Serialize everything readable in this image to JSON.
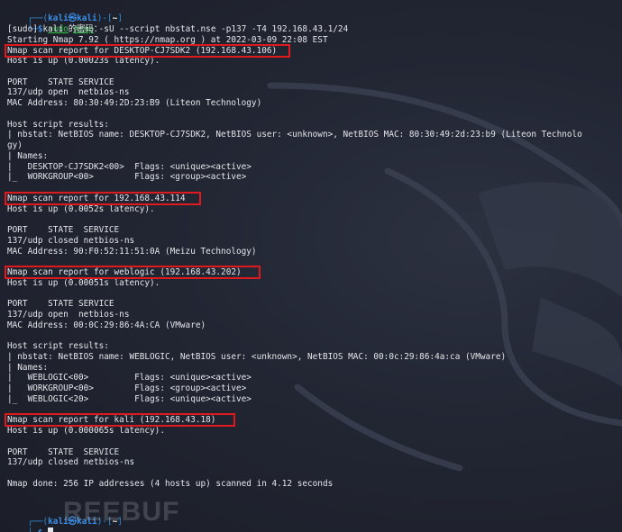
{
  "prompt": {
    "user": "kali",
    "at": "㉿",
    "host": "kali",
    "dir": "~",
    "symbol": "$"
  },
  "command": {
    "sudo": "sudo",
    "nmap": "nmap",
    "args": "-sU --script nbstat.nse -p137 -T4 192.168.43.1/24"
  },
  "lines": [
    "[sudo] kali 的密码：",
    "Starting Nmap 7.92 ( https://nmap.org ) at 2022-03-09 22:08 EST",
    "Nmap scan report for DESKTOP-CJ7SDK2 (192.168.43.106)",
    "Host is up (0.00023s latency).",
    "",
    "PORT    STATE SERVICE",
    "137/udp open  netbios-ns",
    "MAC Address: 80:30:49:2D:23:B9 (Liteon Technology)",
    "",
    "Host script results:",
    "| nbstat: NetBIOS name: DESKTOP-CJ7SDK2, NetBIOS user: <unknown>, NetBIOS MAC: 80:30:49:2d:23:b9 (Liteon Technolo",
    "gy)",
    "| Names:",
    "|   DESKTOP-CJ7SDK2<00>  Flags: <unique><active>",
    "|_  WORKGROUP<00>        Flags: <group><active>",
    "",
    "Nmap scan report for 192.168.43.114",
    "Host is up (0.0052s latency).",
    "",
    "PORT    STATE  SERVICE",
    "137/udp closed netbios-ns",
    "MAC Address: 90:F0:52:11:51:0A (Meizu Technology)",
    "",
    "Nmap scan report for weblogic (192.168.43.202)",
    "Host is up (0.00051s latency).",
    "",
    "PORT    STATE SERVICE",
    "137/udp open  netbios-ns",
    "MAC Address: 00:0C:29:86:4A:CA (VMware)",
    "",
    "Host script results:",
    "| nbstat: NetBIOS name: WEBLOGIC, NetBIOS user: <unknown>, NetBIOS MAC: 00:0c:29:86:4a:ca (VMware)",
    "| Names:",
    "|   WEBLOGIC<00>         Flags: <unique><active>",
    "|   WORKGROUP<00>        Flags: <group><active>",
    "|_  WEBLOGIC<20>         Flags: <unique><active>",
    "",
    "Nmap scan report for kali (192.168.43.18)",
    "Host is up (0.000065s latency).",
    "",
    "PORT    STATE  SERVICE",
    "137/udp closed netbios-ns",
    "",
    "Nmap done: 256 IP addresses (4 hosts up) scanned in 4.12 seconds"
  ],
  "highlighted_lines": [
    2,
    16,
    23,
    37
  ],
  "watermark": "REEBUF",
  "colors": {
    "background": "#1f2330",
    "text": "#e4e6ea",
    "prompt_blue": "#2f8dd6",
    "command_green": "#37c84a",
    "highlight_red": "#e0191c"
  }
}
